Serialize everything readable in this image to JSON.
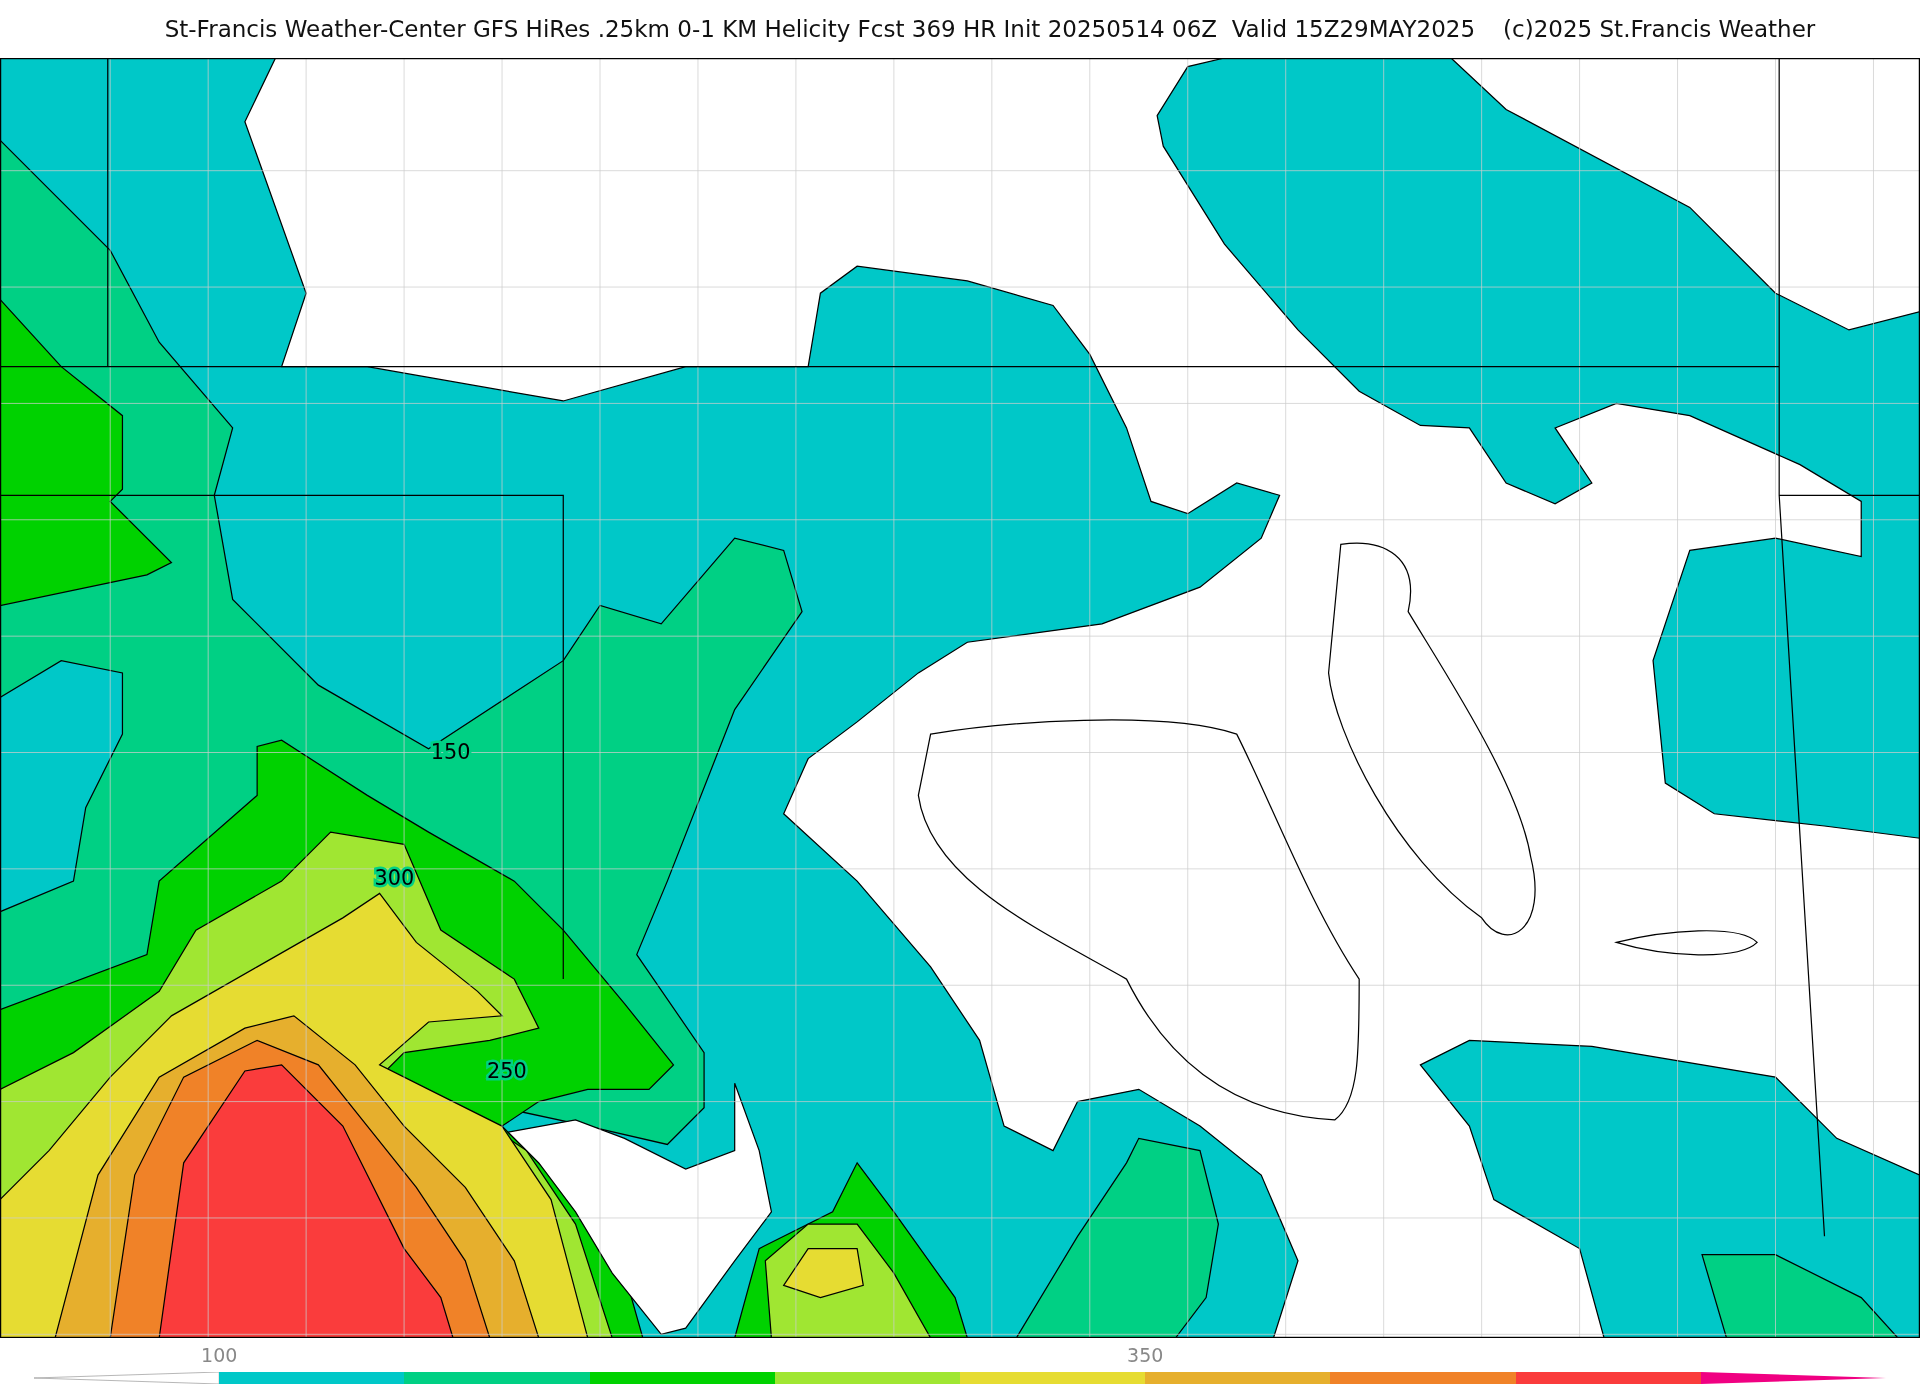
{
  "header": {
    "title": "St-Francis Weather-Center GFS HiRes .25km 0-1 KM Helicity Fcst 369 HR Init 20250514 06Z  Valid 15Z29MAY2025",
    "credit": "(c)2025 St.Francis Weather"
  },
  "map": {
    "contour_labels": [
      {
        "text": "150"
      },
      {
        "text": "300"
      },
      {
        "text": "250"
      }
    ]
  },
  "colorbar": {
    "segments": [
      {
        "kind": "arrow-left",
        "color": "#ffffff"
      },
      {
        "kind": "box",
        "color": "#00c8c8",
        "tick_label": "100"
      },
      {
        "kind": "box",
        "color": "#00d084"
      },
      {
        "kind": "box",
        "color": "#00d200"
      },
      {
        "kind": "box",
        "color": "#a0e632"
      },
      {
        "kind": "box",
        "color": "#e6dc32"
      },
      {
        "kind": "box",
        "color": "#e6af2d",
        "tick_label": "350"
      },
      {
        "kind": "box",
        "color": "#f08228"
      },
      {
        "kind": "box",
        "color": "#fa3c3c"
      },
      {
        "kind": "arrow-right",
        "color": "#f00082"
      }
    ]
  }
}
